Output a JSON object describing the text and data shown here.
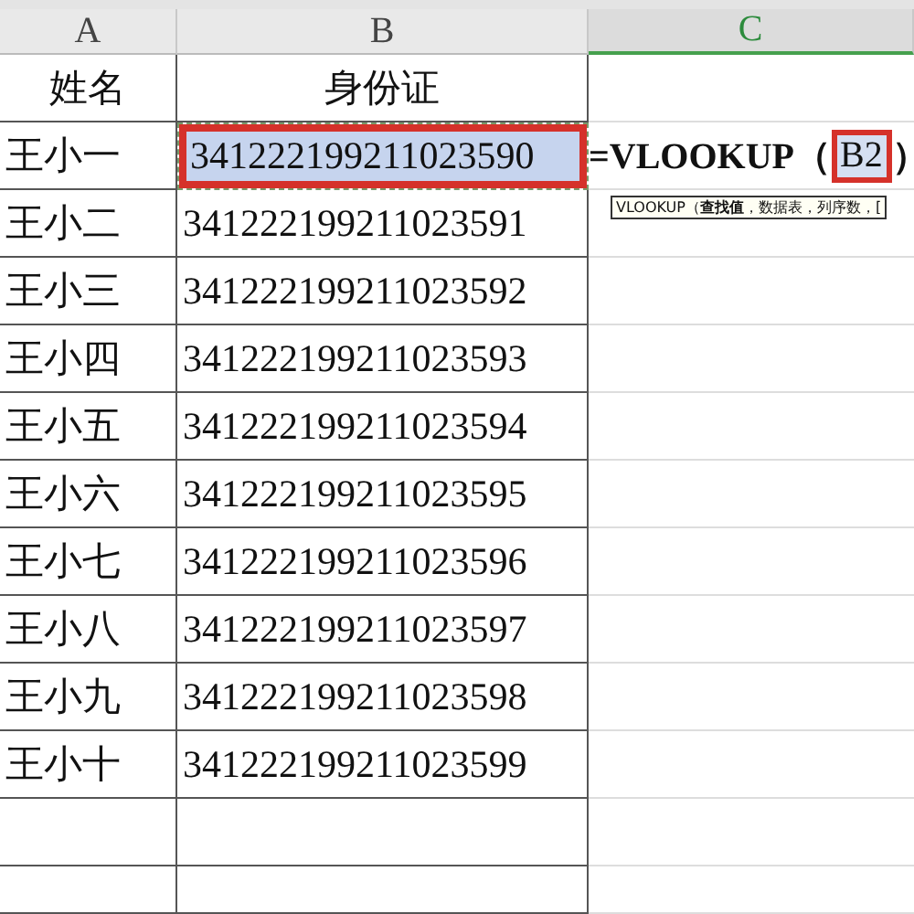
{
  "columns": [
    {
      "label": "A",
      "selected": false
    },
    {
      "label": "B",
      "selected": false
    },
    {
      "label": "C",
      "selected": true
    }
  ],
  "header_row": [
    "姓名",
    "身份证"
  ],
  "rows": [
    {
      "name": "王小一",
      "id": "341222199211023590",
      "selected": true
    },
    {
      "name": "王小二",
      "id": "341222199211023591",
      "selected": false
    },
    {
      "name": "王小三",
      "id": "341222199211023592",
      "selected": false
    },
    {
      "name": "王小四",
      "id": "341222199211023593",
      "selected": false
    },
    {
      "name": "王小五",
      "id": "341222199211023594",
      "selected": false
    },
    {
      "name": "王小六",
      "id": "341222199211023595",
      "selected": false
    },
    {
      "name": "王小七",
      "id": "341222199211023596",
      "selected": false
    },
    {
      "name": "王小八",
      "id": "341222199211023597",
      "selected": false
    },
    {
      "name": "王小九",
      "id": "341222199211023598",
      "selected": false
    },
    {
      "name": "王小十",
      "id": "341222199211023599",
      "selected": false
    }
  ],
  "formula": {
    "prefix": "=VLOOKUP（",
    "reference": "B2",
    "suffix": "）"
  },
  "tooltip": "VLOOKUP（**查找值**，数据表，列序数，["
}
